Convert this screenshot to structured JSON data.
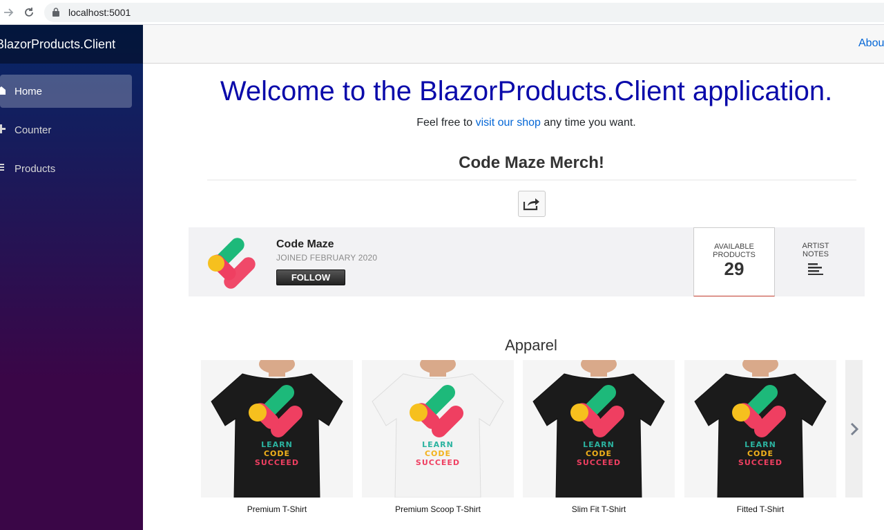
{
  "browser": {
    "url": "localhost:5001"
  },
  "sidebar": {
    "brand": "BlazorProducts.Client",
    "items": [
      {
        "label": "Home",
        "icon": "home-icon",
        "active": true
      },
      {
        "label": "Counter",
        "icon": "plus-icon",
        "active": false
      },
      {
        "label": "Products",
        "icon": "list-icon",
        "active": false
      }
    ]
  },
  "top_row": {
    "about_label": "About"
  },
  "main": {
    "welcome": "Welcome to the BlazorProducts.Client application.",
    "sub_before": "Feel free to ",
    "sub_link": "visit our shop",
    "sub_after": " any time you want.",
    "merch_title": "Code Maze Merch!"
  },
  "profile": {
    "name": "Code Maze",
    "joined": "JOINED FEBRUARY 2020",
    "follow_label": "FOLLOW",
    "stat_label": "AVAILABLE PRODUCTS",
    "stat_value": "29",
    "notes_label": "ARTIST NOTES"
  },
  "apparel": {
    "title": "Apparel",
    "products": [
      {
        "name": "Premium T-Shirt",
        "shirt": "black",
        "print": [
          "LEARN",
          "CODE",
          "SUCCEED"
        ]
      },
      {
        "name": "Premium Scoop T-Shirt",
        "shirt": "white",
        "print": [
          "LEARN",
          "CODE",
          "SUCCEED"
        ]
      },
      {
        "name": "Slim Fit T-Shirt",
        "shirt": "black",
        "print": [
          "LEARN",
          "CODE",
          "SUCCEED"
        ]
      },
      {
        "name": "Fitted T-Shirt",
        "shirt": "black",
        "print": [
          "LEARN",
          "CODE",
          "SUCCEED"
        ]
      }
    ]
  },
  "colors": {
    "welcome": "#0a0aaa",
    "link": "#0366d6",
    "logo_green": "#1db97a",
    "logo_yellow": "#f6c01e",
    "logo_red": "#ef3f61"
  }
}
